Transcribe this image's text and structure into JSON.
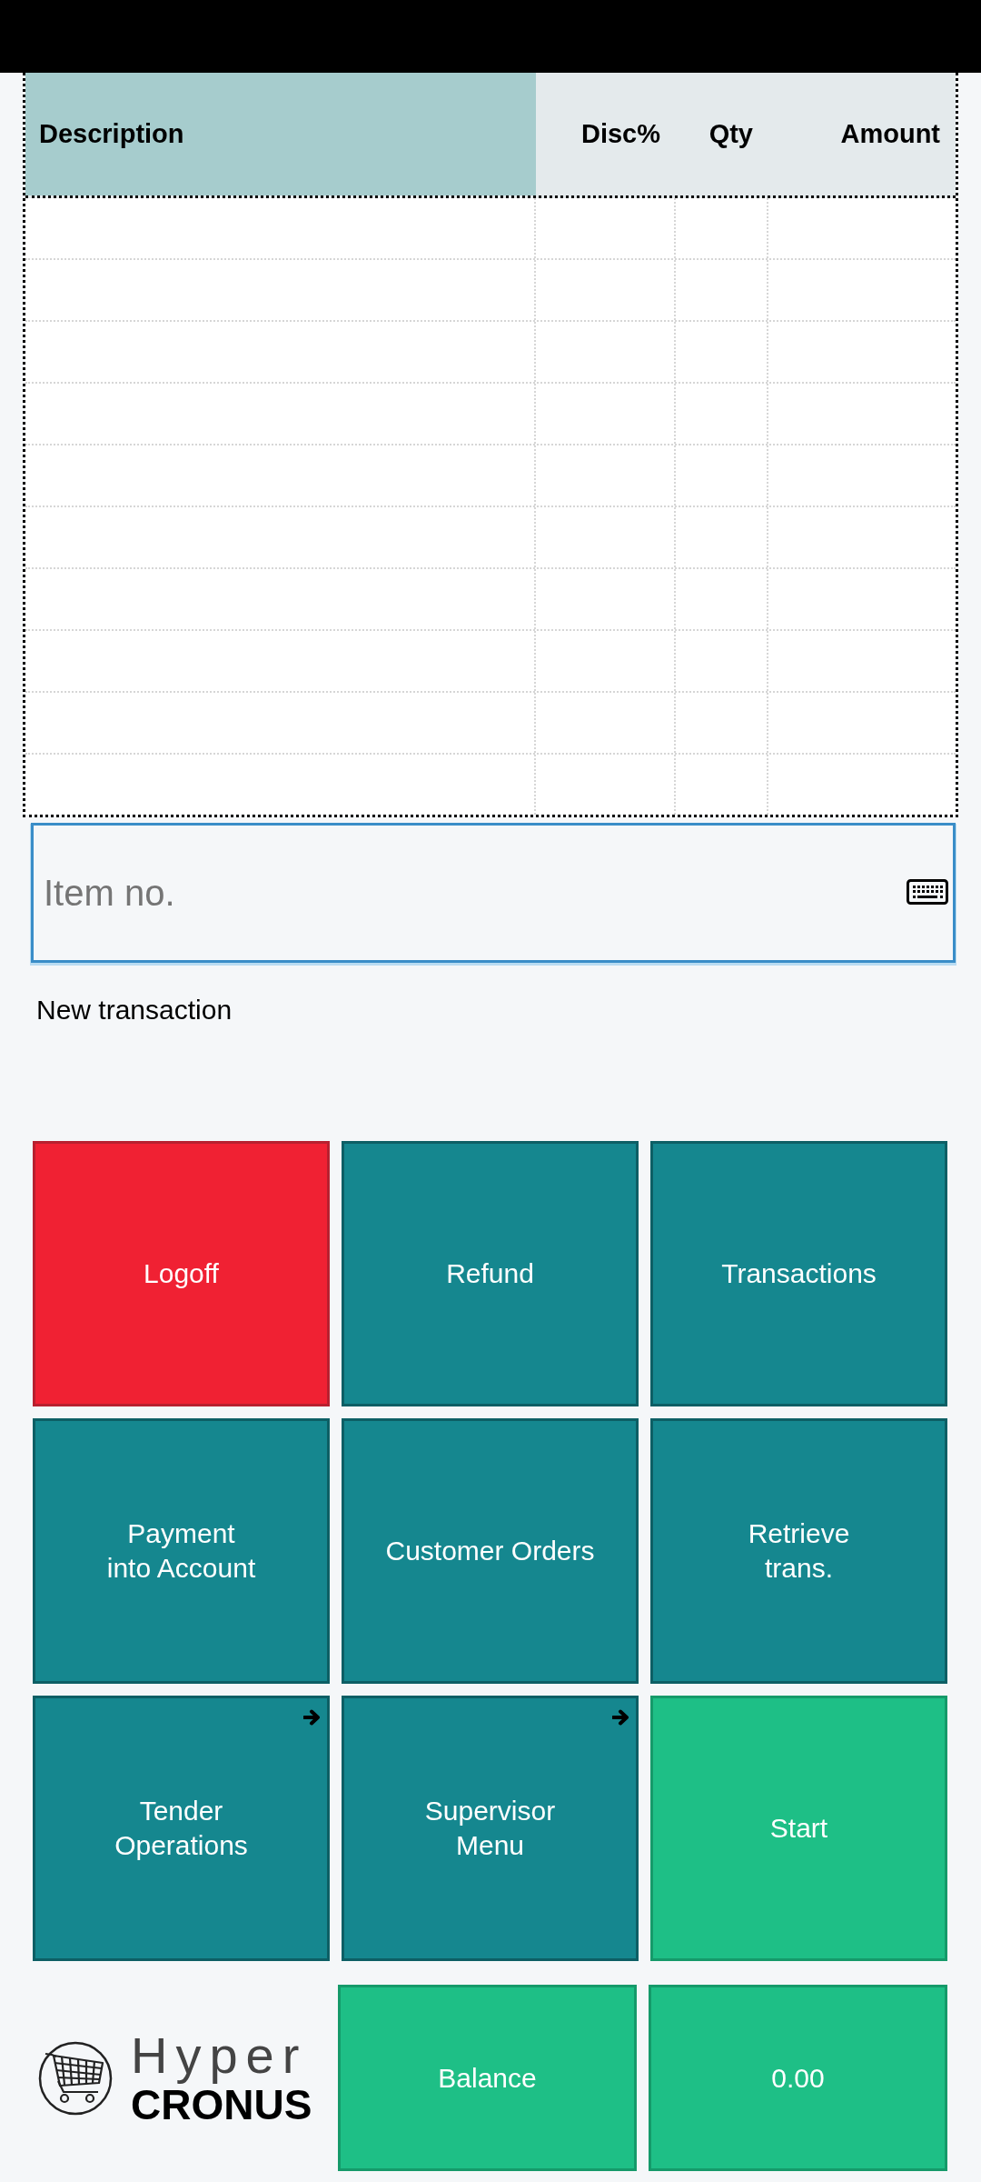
{
  "table": {
    "columns": [
      {
        "label": "Description",
        "selected": true
      },
      {
        "label": "Disc%",
        "selected": false
      },
      {
        "label": "Qty",
        "selected": false
      },
      {
        "label": "Amount",
        "selected": false
      }
    ]
  },
  "item_input": {
    "placeholder": "Item no."
  },
  "status_text": "New transaction",
  "buttons": [
    {
      "label": "Logoff",
      "kind": "danger",
      "submenu": false
    },
    {
      "label": "Refund",
      "kind": "primary",
      "submenu": false
    },
    {
      "label": "Transactions",
      "kind": "primary",
      "submenu": false
    },
    {
      "label": "Payment\ninto Account",
      "kind": "primary",
      "submenu": false
    },
    {
      "label": "Customer Orders",
      "kind": "primary",
      "submenu": false
    },
    {
      "label": "Retrieve\ntrans.",
      "kind": "primary",
      "submenu": false
    },
    {
      "label": "Tender\nOperations",
      "kind": "primary",
      "submenu": true
    },
    {
      "label": "Supervisor\nMenu",
      "kind": "primary",
      "submenu": true
    },
    {
      "label": "Start",
      "kind": "success",
      "submenu": false
    }
  ],
  "footer": {
    "logo": {
      "line_1": "Hyper",
      "line_2": "CRONUS"
    },
    "tiles": [
      {
        "label": "Balance",
        "kind": "success"
      },
      {
        "label": "0.00",
        "kind": "success"
      }
    ]
  }
}
